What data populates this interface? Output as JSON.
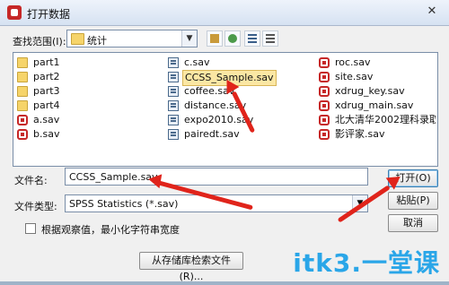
{
  "window": {
    "title": "打开数据",
    "close_glyph": "✕"
  },
  "toolbar": {
    "look_in_label": "查找范围(I):",
    "look_in_value": "统计",
    "dropdown_glyph": "▼"
  },
  "files": [
    {
      "name": "part1",
      "icon": "folder-icon",
      "kind": "folder"
    },
    {
      "name": "part2",
      "icon": "folder-icon",
      "kind": "folder"
    },
    {
      "name": "part3",
      "icon": "folder-icon",
      "kind": "folder"
    },
    {
      "name": "part4",
      "icon": "folder-icon",
      "kind": "folder"
    },
    {
      "name": "a.sav",
      "icon": "sav-file-icon",
      "kind": "sav"
    },
    {
      "name": "b.sav",
      "icon": "sav-file-icon",
      "kind": "sav"
    },
    {
      "name": "c.sav",
      "icon": "data-file-icon",
      "kind": "data"
    },
    {
      "name": "CCSS_Sample.sav",
      "icon": "data-file-icon",
      "kind": "data",
      "selected": true
    },
    {
      "name": "coffee.sav",
      "icon": "data-file-icon",
      "kind": "data"
    },
    {
      "name": "distance.sav",
      "icon": "data-file-icon",
      "kind": "data"
    },
    {
      "name": "expo2010.sav",
      "icon": "data-file-icon",
      "kind": "data"
    },
    {
      "name": "pairedt.sav",
      "icon": "data-file-icon",
      "kind": "data"
    },
    {
      "name": "roc.sav",
      "icon": "sav-file-icon",
      "kind": "sav"
    },
    {
      "name": "site.sav",
      "icon": "sav-file-icon",
      "kind": "sav"
    },
    {
      "name": "xdrug_key.sav",
      "icon": "sav-file-icon",
      "kind": "sav"
    },
    {
      "name": "xdrug_main.sav",
      "icon": "sav-file-icon",
      "kind": "sav"
    },
    {
      "name": "北大清华2002理科录取比",
      "icon": "sav-file-icon",
      "kind": "sav"
    },
    {
      "name": "影评家.sav",
      "icon": "sav-file-icon",
      "kind": "sav"
    }
  ],
  "form": {
    "filename_label": "文件名:",
    "filename_value": "CCSS_Sample.sav",
    "filetype_label": "文件类型:",
    "filetype_value": "SPSS Statistics (*.sav)",
    "checkbox_label": "根据观察值，最小化字符串宽度",
    "repository_button": "从存储库检索文件(R)..."
  },
  "buttons": {
    "open": "打开(O)",
    "paste": "粘贴(P)",
    "cancel": "取消"
  },
  "colors": {
    "annotation_arrow": "#e0241b",
    "watermark": "#1aa0e8"
  },
  "watermark": "itk3.一堂课"
}
